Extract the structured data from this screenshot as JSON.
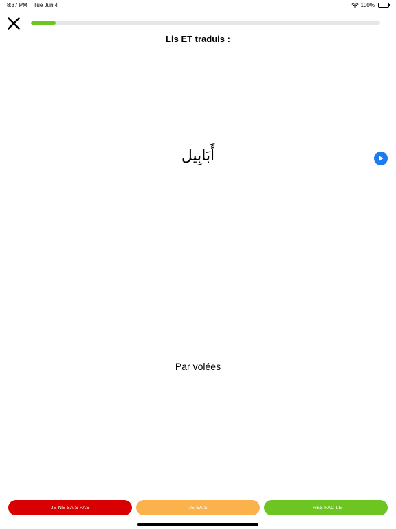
{
  "status_bar": {
    "time": "8:37 PM",
    "date": "Tue Jun 4",
    "battery": "100%"
  },
  "progress": {
    "value": 0.07,
    "color": "#6cc520"
  },
  "exercise": {
    "instruction": "Lis ET traduis :",
    "word": "أَبَابِيل",
    "translation": "Par volées"
  },
  "buttons": {
    "dont_know": "JE NE SAIS PAS",
    "know": "JE SAIS",
    "very_easy": "TRÈS FACILE"
  },
  "colors": {
    "dont_know": "#d80000",
    "know": "#fbb24d",
    "very_easy": "#6cc520",
    "audio": "#1a7cf0"
  },
  "icons": {
    "close": "close-icon",
    "play": "play-icon",
    "wifi": "wifi-icon",
    "battery": "battery-icon"
  }
}
